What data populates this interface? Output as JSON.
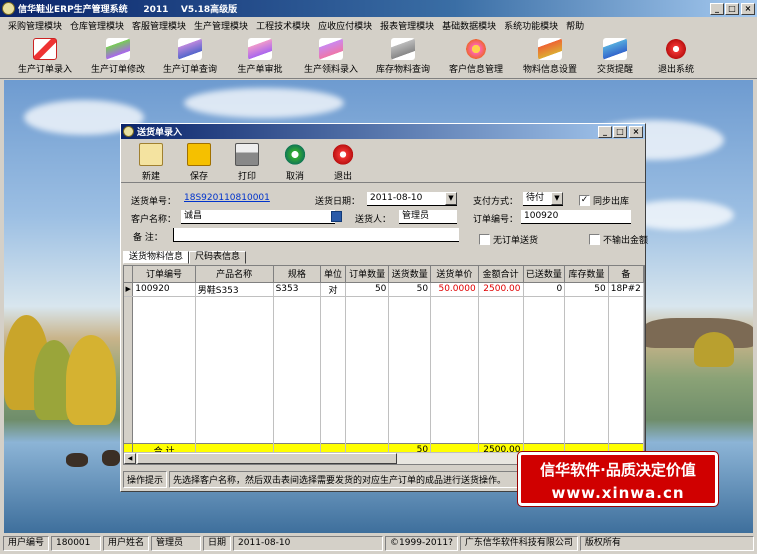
{
  "app": {
    "title": "信华鞋业ERP生产管理系统     2011    V5.18高级版"
  },
  "window_buttons": {
    "minimize": "_",
    "maximize": "□",
    "close": "×"
  },
  "menu": [
    "采购管理模块",
    "仓库管理模块",
    "客服管理模块",
    "生产管理模块",
    "工程技术模块",
    "应收应付模块",
    "报表管理模块",
    "基础数据模块",
    "系统功能模块",
    "帮助"
  ],
  "toolbar": [
    {
      "label": "生产订单录入",
      "icon": "pdf-icon"
    },
    {
      "label": "生产订单修改",
      "icon": "feather-icon"
    },
    {
      "label": "生产订单查询",
      "icon": "feather-icon"
    },
    {
      "label": "生产单审批",
      "icon": "feather-icon"
    },
    {
      "label": "生产领料录入",
      "icon": "feather-icon"
    },
    {
      "label": "库存物料查询",
      "icon": "feather-icon"
    },
    {
      "label": "客户信息管理",
      "icon": "flower-icon"
    },
    {
      "label": "物料信息设置",
      "icon": "feather-icon"
    },
    {
      "label": "交货提醒",
      "icon": "feather-icon"
    },
    {
      "label": "退出系统",
      "icon": "exit-icon"
    }
  ],
  "dialog": {
    "title": "送货单录入",
    "buttons": {
      "new": "新建",
      "save": "保存",
      "print": "打印",
      "cancel": "取消",
      "exit": "退出"
    },
    "form": {
      "delivery_no_label": "送货单号：",
      "delivery_no": "18S920110810001",
      "delivery_date_label": "送货日期：",
      "delivery_date": "2011-08-10",
      "payment_label": "支付方式：",
      "payment": "待付",
      "sync_label": "同步出库",
      "sync_checked": "✓",
      "customer_label": "客户名称：",
      "customer": "诚昌",
      "sender_label": "送货人：",
      "sender": "管理员",
      "order_no_label": "订单编号：",
      "order_no": "100920",
      "remark_label": "备  注：",
      "remark": "",
      "no_order_label": "无订单送货",
      "no_amount_label": "不输出金额"
    },
    "tabs": [
      "送货物料信息",
      "尺码表信息"
    ],
    "grid": {
      "columns": [
        "订单编号",
        "产品名称",
        "规格",
        "单位",
        "订单数量",
        "送货数量",
        "送货单价",
        "金额合计",
        "已送数量",
        "库存数量",
        "备"
      ],
      "rows": [
        [
          "100920",
          "男鞋S353",
          "S353",
          "对",
          "50",
          "50",
          "50.0000",
          "2500.00",
          "0",
          "50",
          "18P#2"
        ]
      ],
      "total": {
        "label": "合 计",
        "delivery_qty": "50",
        "amount": "2500.00"
      }
    },
    "hint": {
      "label": "操作提示",
      "text": "先选择客户名称，然后双击表间选择需要发货的对应生产订单的成品进行送货操作。"
    }
  },
  "promo": {
    "line1": "信华软件·品质决定价值",
    "line2": "www.xinwa.cn"
  },
  "statusbar": {
    "user_no_label": "用户编号",
    "user_no": "180001",
    "user_name_label": "用户姓名",
    "user_name": "管理员",
    "date_label": "日期",
    "date": "2011-08-10",
    "copyright": "©1999-2011?",
    "company": "广东信华软件科技有限公司",
    "rights": "版权所有"
  },
  "colors": {
    "title_bar": "#0a246a",
    "total_row": "#ffff00",
    "link": "#0033cc",
    "price_red": "#e00000",
    "promo": "#d00000"
  }
}
